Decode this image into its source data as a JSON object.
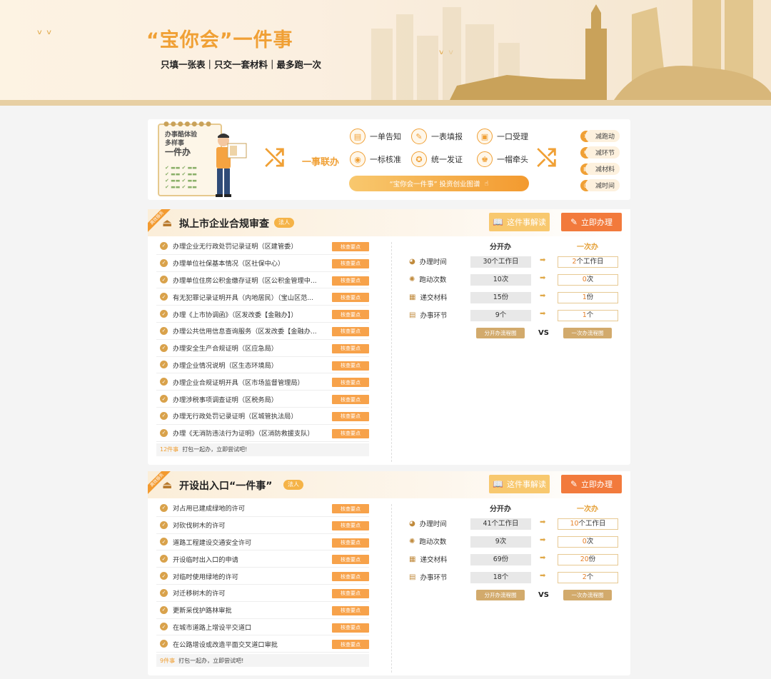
{
  "banner": {
    "title": "“宝你会”一件事",
    "subtitle": "只填一张表｜只交一套材料｜最多跑一次"
  },
  "intro": {
    "notepad_small": "办事酷体验\n多样事",
    "notepad_big": "一件办",
    "lianban": "一事联办",
    "features": [
      {
        "icon": "notice-icon",
        "label": "一单告知"
      },
      {
        "icon": "form-icon",
        "label": "一表填报"
      },
      {
        "icon": "accept-icon",
        "label": "一口受理"
      },
      {
        "icon": "standard-icon",
        "label": "一标核准"
      },
      {
        "icon": "certificate-icon",
        "label": "统一发证"
      },
      {
        "icon": "lead-icon",
        "label": "一帽牵头"
      }
    ],
    "guide_button": "“宝你会一件事” 投资创业图谱",
    "reductions": [
      "减跑动",
      "减环节",
      "减材料",
      "减时间"
    ]
  },
  "sections": [
    {
      "ribbon": "高效服务",
      "title": "拟上市企业合规审查",
      "tag": "法人",
      "btn_jiedu": "这件事解读",
      "btn_banli": "立即办理",
      "check_label": "核查要点",
      "items": [
        "办理企业无行政处罚记录证明（区建管委）",
        "办理单位社保基本情况（区社保中心）",
        "办理单位住房公积金缴存证明（区公积金管理中...",
        "有无犯罪记录证明开具（内地居民）（宝山区范...",
        "办理《上市协调函》（区发改委【金融办】）",
        "办理公共信用信息查询服务（区发改委【金融办...",
        "办理安全生产合规证明（区应急局）",
        "办理企业情况说明（区生态环境局）",
        "办理企业合规证明开具（区市场监督管理局）",
        "办理涉税事项调查证明（区税务局）",
        "办理无行政处罚记录证明（区城管执法局）",
        "办理《无消防违法行为证明》（区消防救援支队）"
      ],
      "count": "12件事",
      "foot": "打包一起办，立即尝试吧!",
      "cmp_head_a": "分开办",
      "cmp_head_b": "一次办",
      "rows": [
        {
          "icon": "clock-icon",
          "label": "办理时间",
          "a_num": "30",
          "a_unit": "个工作日",
          "b_num": "2",
          "b_unit": "个工作日"
        },
        {
          "icon": "run-icon",
          "label": "跑动次数",
          "a_num": "10",
          "a_unit": "次",
          "b_num": "0",
          "b_unit": "次"
        },
        {
          "icon": "material-icon",
          "label": "递交材料",
          "a_num": "15",
          "a_unit": "份",
          "b_num": "1",
          "b_unit": "份"
        },
        {
          "icon": "step-icon",
          "label": "办事环节",
          "a_num": "9",
          "a_unit": "个",
          "b_num": "1",
          "b_unit": "个"
        }
      ],
      "flow_a": "分开办流程图",
      "vs": "VS",
      "flow_b": "一次办流程图"
    },
    {
      "ribbon": "高效服务",
      "title": "开设出入口“一件事”",
      "tag": "法人",
      "btn_jiedu": "这件事解读",
      "btn_banli": "立即办理",
      "check_label": "核查要点",
      "items": [
        "对占用已建成绿地的许可",
        "对砍伐树木的许可",
        "道路工程建设交通安全许可",
        "开设临时出入口的申请",
        "对临时使用绿地的许可",
        "对迁移树木的许可",
        "更新采伐护路林审批",
        "在城市道路上增设平交道口",
        "在公路增设或改造平面交叉道口审批"
      ],
      "count": "9件事",
      "foot": "打包一起办，立即尝试吧!",
      "cmp_head_a": "分开办",
      "cmp_head_b": "一次办",
      "rows": [
        {
          "icon": "clock-icon",
          "label": "办理时间",
          "a_num": "41",
          "a_unit": "个工作日",
          "b_num": "10",
          "b_unit": "个工作日"
        },
        {
          "icon": "run-icon",
          "label": "跑动次数",
          "a_num": "9",
          "a_unit": "次",
          "b_num": "0",
          "b_unit": "次"
        },
        {
          "icon": "material-icon",
          "label": "递交材料",
          "a_num": "69",
          "a_unit": "份",
          "b_num": "20",
          "b_unit": "份"
        },
        {
          "icon": "step-icon",
          "label": "办事环节",
          "a_num": "18",
          "a_unit": "个",
          "b_num": "2",
          "b_unit": "个"
        }
      ],
      "flow_a": "分开办流程图",
      "vs": "VS",
      "flow_b": "一次办流程图"
    }
  ]
}
